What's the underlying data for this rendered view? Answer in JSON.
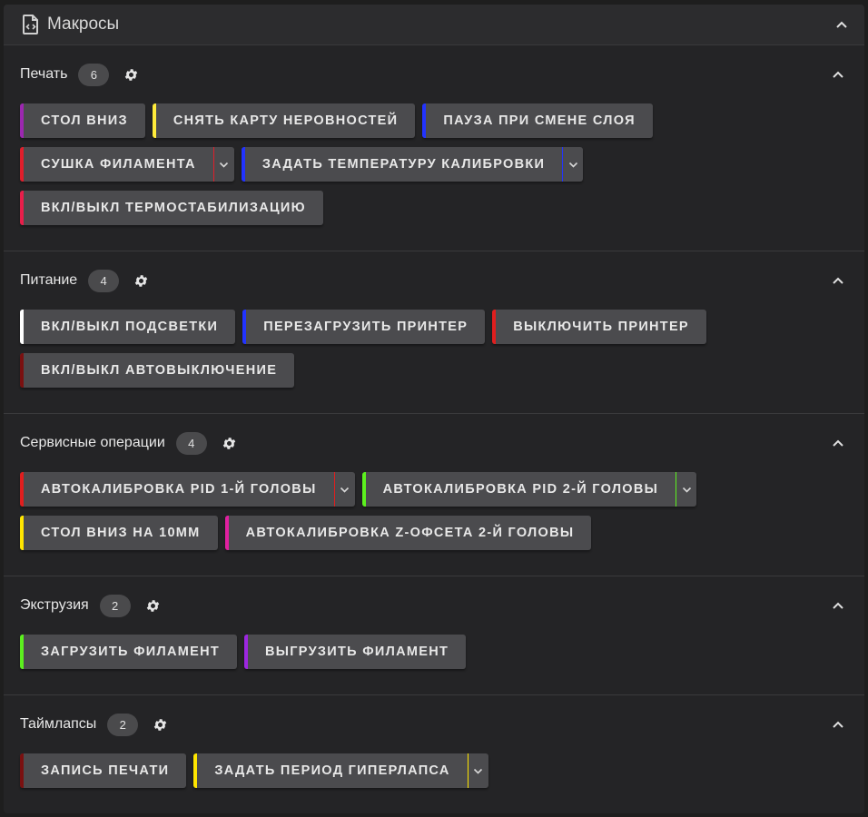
{
  "header": {
    "title": "Макросы"
  },
  "sections": [
    {
      "title": "Печать",
      "count": "6",
      "rows": [
        [
          {
            "label": "СТОЛ ВНИЗ",
            "color": "#9c27b0",
            "dropdown": false
          },
          {
            "label": "СНЯТЬ КАРТУ НЕРОВНОСТЕЙ",
            "color": "#ffeb3b",
            "dropdown": false
          },
          {
            "label": "ПАУЗА ПРИ СМЕНЕ СЛОЯ",
            "color": "#2233ff",
            "dropdown": false
          }
        ],
        [
          {
            "label": "СУШКА ФИЛАМЕНТА",
            "color": "#e01e2b",
            "dropdown": true
          },
          {
            "label": "ЗАДАТЬ ТЕМПЕРАТУРУ КАЛИБРОВКИ",
            "color": "#2233ff",
            "dropdown": true
          }
        ],
        [
          {
            "label": "ВКЛ/ВЫКЛ ТЕРМОСТАБИЛИЗАЦИЮ",
            "color": "#e81e4a",
            "dropdown": false
          }
        ]
      ]
    },
    {
      "title": "Питание",
      "count": "4",
      "rows": [
        [
          {
            "label": "ВКЛ/ВЫКЛ ПОДСВЕТКИ",
            "color": "#ffffff",
            "dropdown": false
          },
          {
            "label": "ПЕРЕЗАГРУЗИТЬ ПРИНТЕР",
            "color": "#2233ff",
            "dropdown": false
          },
          {
            "label": "ВЫКЛЮЧИТЬ ПРИНТЕР",
            "color": "#e01e1e",
            "dropdown": false
          }
        ],
        [
          {
            "label": "ВКЛ/ВЫКЛ АВТОВЫКЛЮЧЕНИЕ",
            "color": "#7a1010",
            "dropdown": false
          }
        ]
      ]
    },
    {
      "title": "Сервисные операции",
      "count": "4",
      "rows": [
        [
          {
            "label": "АВТОКАЛИБРОВКА PID 1-Й ГОЛОВЫ",
            "color": "#e01e1e",
            "dropdown": true
          },
          {
            "label": "АВТОКАЛИБРОВКА PID 2-Й ГОЛОВЫ",
            "color": "#5cf01e",
            "dropdown": true
          }
        ],
        [
          {
            "label": "СТОЛ ВНИЗ НА 10ММ",
            "color": "#ffe500",
            "dropdown": false
          },
          {
            "label": "АВТОКАЛИБРОВКА Z-ОФСЕТА 2-Й ГОЛОВЫ",
            "color": "#e020a0",
            "dropdown": false
          }
        ]
      ]
    },
    {
      "title": "Экструзия",
      "count": "2",
      "rows": [
        [
          {
            "label": "ЗАГРУЗИТЬ ФИЛАМЕНТ",
            "color": "#5cf01e",
            "dropdown": false
          },
          {
            "label": "ВЫГРУЗИТЬ ФИЛАМЕНТ",
            "color": "#9c27e0",
            "dropdown": false
          }
        ]
      ]
    },
    {
      "title": "Таймлапсы",
      "count": "2",
      "rows": [
        [
          {
            "label": "ЗАПИСЬ ПЕЧАТИ",
            "color": "#7a1010",
            "dropdown": false
          },
          {
            "label": "ЗАДАТЬ ПЕРИОД ГИПЕРЛАПСА",
            "color": "#ffe500",
            "dropdown": true
          }
        ]
      ]
    }
  ]
}
